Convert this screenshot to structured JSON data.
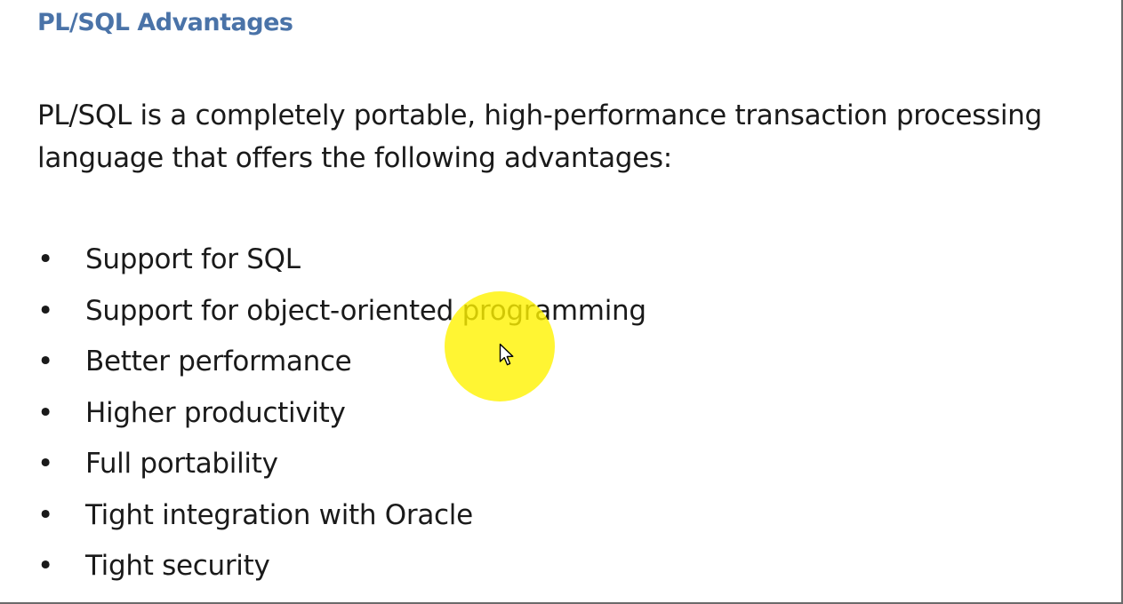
{
  "slide": {
    "heading": "PL/SQL Advantages",
    "intro": "PL/SQL is a completely portable, high-performance transaction processing language that offers the following advantages:",
    "bullet_glyph": "•",
    "bullets": [
      "Support for SQL",
      "Support for object-oriented programming",
      "Better performance",
      "Higher productivity",
      "Full portability",
      "Tight integration with Oracle",
      "Tight security"
    ]
  },
  "colors": {
    "heading": "#4a73a8",
    "body_text": "#1a1a1a",
    "cursor_highlight": "#fff200"
  },
  "icons": {
    "cursor": "mouse-pointer-icon"
  }
}
